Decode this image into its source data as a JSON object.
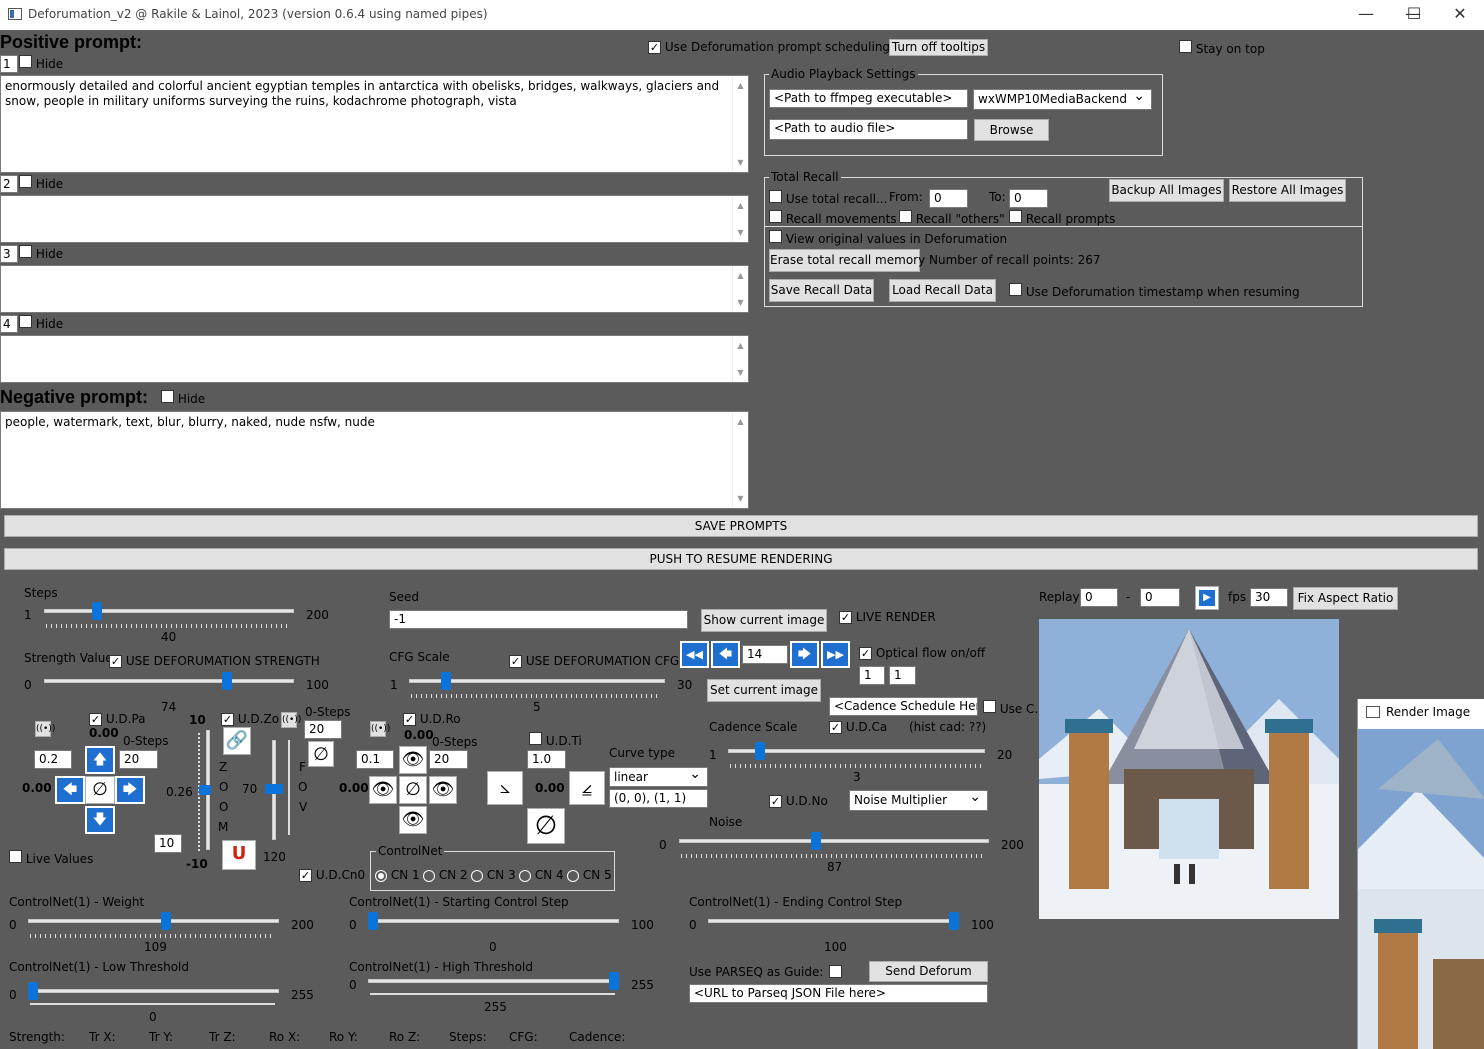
{
  "window": {
    "title": "Deforumation_v2 @ Rakile & Lainol, 2023 (version 0.6.4 using named pipes)",
    "min": "—",
    "max": "☐",
    "close": "✕"
  },
  "colors": {
    "accent": "#0a74da",
    "bg": "#5b5b5b"
  },
  "prompts": {
    "positive_label": "Positive prompt:",
    "negative_label": "Negative prompt:",
    "hide": "Hide",
    "items": [
      {
        "num": "1",
        "text": "enormously detailed and colorful ancient egyptian temples in antarctica with obelisks, bridges, walkways, glaciers and snow, people in military uniforms surveying the ruins, kodachrome photograph, vista"
      },
      {
        "num": "2",
        "text": ""
      },
      {
        "num": "3",
        "text": ""
      },
      {
        "num": "4",
        "text": ""
      }
    ],
    "negative_text": "people, watermark, text, blur, blurry, naked, nude   nsfw, nude"
  },
  "top": {
    "use_scheduling": "Use Deforumation prompt scheduling",
    "tooltips": "Turn off tooltips",
    "stay_on_top": "Stay on top"
  },
  "audio": {
    "title": "Audio Playback Settings",
    "ffmpeg_placeholder": "<Path to ffmpeg executable>",
    "backend": "wxWMP10MediaBackend",
    "audio_placeholder": "<Path to audio file>",
    "browse": "Browse"
  },
  "recall": {
    "title": "Total Recall",
    "use": "Use total recall...",
    "from": "From:",
    "from_val": "0",
    "to": "To:",
    "to_val": "0",
    "backup": "Backup All Images",
    "restore": "Restore All Images",
    "movements": "Recall movements",
    "others": "Recall \"others\"",
    "prompts": "Recall prompts",
    "view_orig": "View original values in Deforumation",
    "erase": "Erase total recall memory",
    "points": "Number of recall points: 267",
    "save": "Save Recall Data",
    "load": "Load Recall Data",
    "use_ts": "Use Deforumation timestamp when resuming"
  },
  "bars": {
    "save": "SAVE PROMPTS",
    "push": "PUSH TO RESUME RENDERING"
  },
  "steps": {
    "label": "Steps",
    "min": "1",
    "max": "200",
    "val": "40",
    "frac": 0.2
  },
  "strength": {
    "label": "Strength Value",
    "use": "USE DEFORUMATION STRENGTH",
    "min": "0",
    "max": "100",
    "val": "74",
    "frac": 0.74
  },
  "pan": {
    "udpa": "U.D.Pa",
    "val": "0.00",
    "step": "0.2",
    "zsteps": "0-Steps",
    "zval": "20",
    "left": "0.00",
    "live": "Live Values"
  },
  "zoom": {
    "udzo": "U.D.Zo",
    "top": "10",
    "bot": "-10",
    "val": "0.26",
    "letters": [
      "Z",
      "O",
      "O",
      "M"
    ],
    "steps": "10",
    "zsteps": "0-Steps",
    "zval": "20"
  },
  "fov": {
    "val": "70",
    "bot": "120",
    "letters": [
      "F",
      "O",
      "V"
    ]
  },
  "rot": {
    "udro": "U.D.Ro",
    "val": "0.00",
    "step": "0.1",
    "zsteps": "0-Steps",
    "zval": "20",
    "left": "0.00"
  },
  "tilt": {
    "udti": "U.D.Ti",
    "val": "1.0",
    "center": "0.00"
  },
  "controlnet": {
    "title": "ControlNet",
    "udcn": "U.D.Cn0",
    "options": [
      "CN 1",
      "CN 2",
      "CN 3",
      "CN 4",
      "CN 5"
    ]
  },
  "seed": {
    "label": "Seed",
    "val": "-1",
    "show": "Show current image",
    "live": "LIVE RENDER"
  },
  "cfg": {
    "label": "CFG Scale",
    "use": "USE DEFORUMATION CFG",
    "min": "1",
    "max": "30",
    "val": "5",
    "frac": 0.13
  },
  "nav": {
    "frame": "14",
    "optical": "Optical flow on/off",
    "a": "1",
    "b": "1",
    "set": "Set current image"
  },
  "cadence": {
    "placeholder": "<Cadence Schedule Here>",
    "usec": "Use C.",
    "label": "Cadence Scale",
    "udca": "U.D.Ca",
    "hist": "(hist cad: ??)",
    "min": "1",
    "max": "20",
    "val": "3",
    "frac": 0.11
  },
  "curve": {
    "label": "Curve type",
    "type": "linear",
    "points": "(0, 0), (1, 1)"
  },
  "noise": {
    "udno": "U.D.No",
    "mult": "Noise Multiplier",
    "label": "Noise",
    "min": "0",
    "max": "200",
    "val": "87",
    "frac": 0.44
  },
  "cn_sliders": [
    {
      "label": "ControlNet(1) - Weight",
      "min": "0",
      "max": "200",
      "val": "109",
      "frac": 0.55
    },
    {
      "label": "ControlNet(1) - Starting Control Step",
      "min": "0",
      "max": "100",
      "val": "0",
      "frac": 0.0
    },
    {
      "label": "ControlNet(1) - Ending Control Step",
      "min": "0",
      "max": "100",
      "val": "100",
      "frac": 1.0
    },
    {
      "label": "ControlNet(1) - Low Threshold",
      "min": "0",
      "max": "255",
      "val": "0",
      "frac": 0.0
    },
    {
      "label": "ControlNet(1) - High Threshold",
      "min": "0",
      "max": "255",
      "val": "255",
      "frac": 1.0
    }
  ],
  "parseq": {
    "label": "Use PARSEQ as Guide:",
    "send": "Send Deforum",
    "placeholder": "<URL to Parseq JSON File here>"
  },
  "replay": {
    "label": "Replay",
    "from": "0",
    "dash": "-",
    "to": "0",
    "fps": "fps",
    "fps_val": "30",
    "fix": "Fix Aspect Ratio"
  },
  "render": {
    "title": "Render Image"
  },
  "status": [
    "Strength:",
    "Tr X:",
    "Tr Y:",
    "Tr Z:",
    "Ro X:",
    "Ro Y:",
    "Ro Z:",
    "Steps:",
    "CFG:",
    "Cadence:"
  ]
}
